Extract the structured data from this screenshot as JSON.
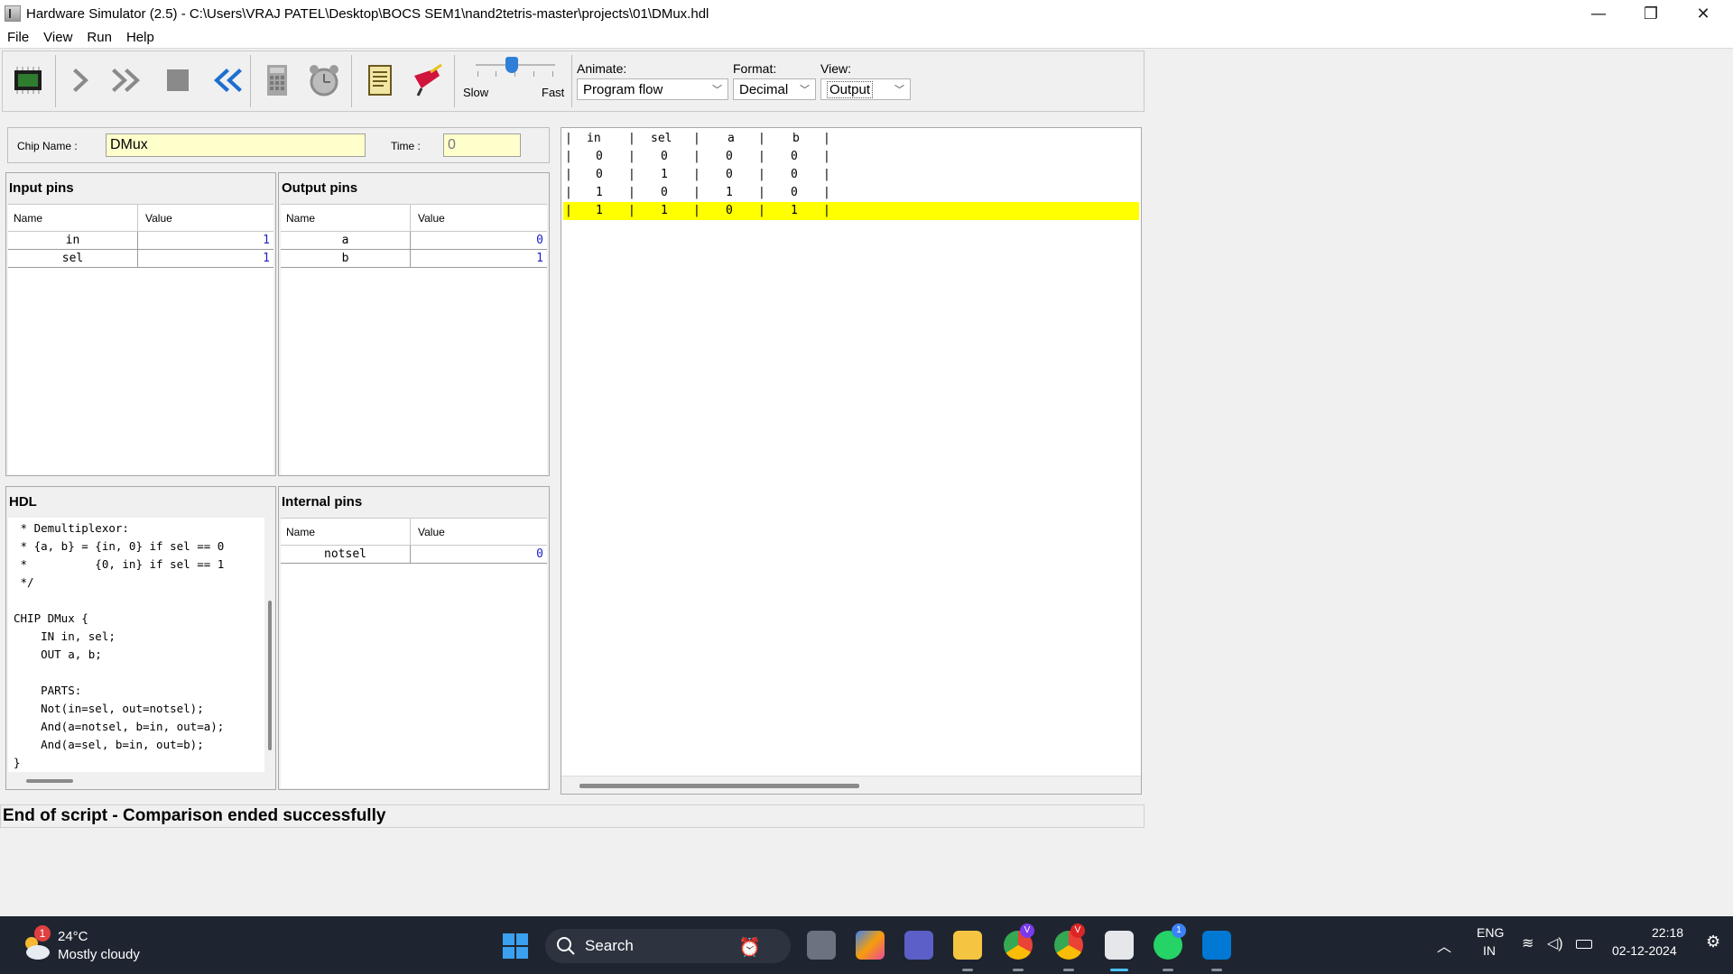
{
  "window": {
    "title": "Hardware Simulator (2.5) - C:\\Users\\VRAJ PATEL\\Desktop\\BOCS SEM1\\nand2tetris-master\\projects\\01\\DMux.hdl",
    "minimize_glyph": "—",
    "maximize_glyph": "❐",
    "close_glyph": "✕"
  },
  "menu": {
    "items": [
      "File",
      "View",
      "Run",
      "Help"
    ]
  },
  "toolbar": {
    "icons": [
      "chip-load-icon",
      "single-step-icon",
      "fast-forward-icon",
      "stop-icon",
      "rewind-icon",
      "eval-icon",
      "clock-icon",
      "script-icon",
      "breakpoint-icon"
    ],
    "speed": {
      "slow_label": "Slow",
      "fast_label": "Fast",
      "level": 0.45
    },
    "animate": {
      "label": "Animate:",
      "value": "Program flow"
    },
    "format": {
      "label": "Format:",
      "value": "Decimal"
    },
    "view": {
      "label": "View:",
      "value": "Output"
    }
  },
  "chip": {
    "name_label": "Chip Name :",
    "name": "DMux",
    "time_label": "Time :",
    "time": "0"
  },
  "input_pins": {
    "title": "Input pins",
    "headers": [
      "Name",
      "Value"
    ],
    "rows": [
      {
        "name": "in",
        "value": "1"
      },
      {
        "name": "sel",
        "value": "1"
      }
    ]
  },
  "output_pins": {
    "title": "Output pins",
    "headers": [
      "Name",
      "Value"
    ],
    "rows": [
      {
        "name": "a",
        "value": "0"
      },
      {
        "name": "b",
        "value": "1"
      }
    ]
  },
  "hdl": {
    "title": "HDL",
    "lines": [
      " * Demultiplexor:",
      " * {a, b} = {in, 0} if sel == 0",
      " *          {0, in} if sel == 1",
      " */",
      "",
      "CHIP DMux {",
      "    IN in, sel;",
      "    OUT a, b;",
      "",
      "    PARTS:",
      "    Not(in=sel, out=notsel);",
      "    And(a=notsel, b=in, out=a);",
      "    And(a=sel, b=in, out=b);",
      "}"
    ]
  },
  "internal_pins": {
    "title": "Internal pins",
    "headers": [
      "Name",
      "Value"
    ],
    "rows": [
      {
        "name": "notsel",
        "value": "0"
      }
    ]
  },
  "output_table": {
    "headers": [
      "in",
      "sel",
      "a",
      "b"
    ],
    "rows": [
      [
        "0",
        "0",
        "0",
        "0"
      ],
      [
        "0",
        "1",
        "0",
        "0"
      ],
      [
        "1",
        "0",
        "1",
        "0"
      ],
      [
        "1",
        "1",
        "0",
        "1"
      ]
    ],
    "highlight_color": "#ffff00"
  },
  "status": "End of script - Comparison ended successfully",
  "taskbar": {
    "weather": {
      "temp": "24°C",
      "desc": "Mostly cloudy",
      "badge": "1"
    },
    "search_label": "Search",
    "lang": "ENG",
    "region": "IN",
    "time": "22:18",
    "date": "02-12-2024",
    "whatsapp_badge": "1",
    "chrome_profile_1": "V",
    "chrome_profile_2": "V"
  }
}
